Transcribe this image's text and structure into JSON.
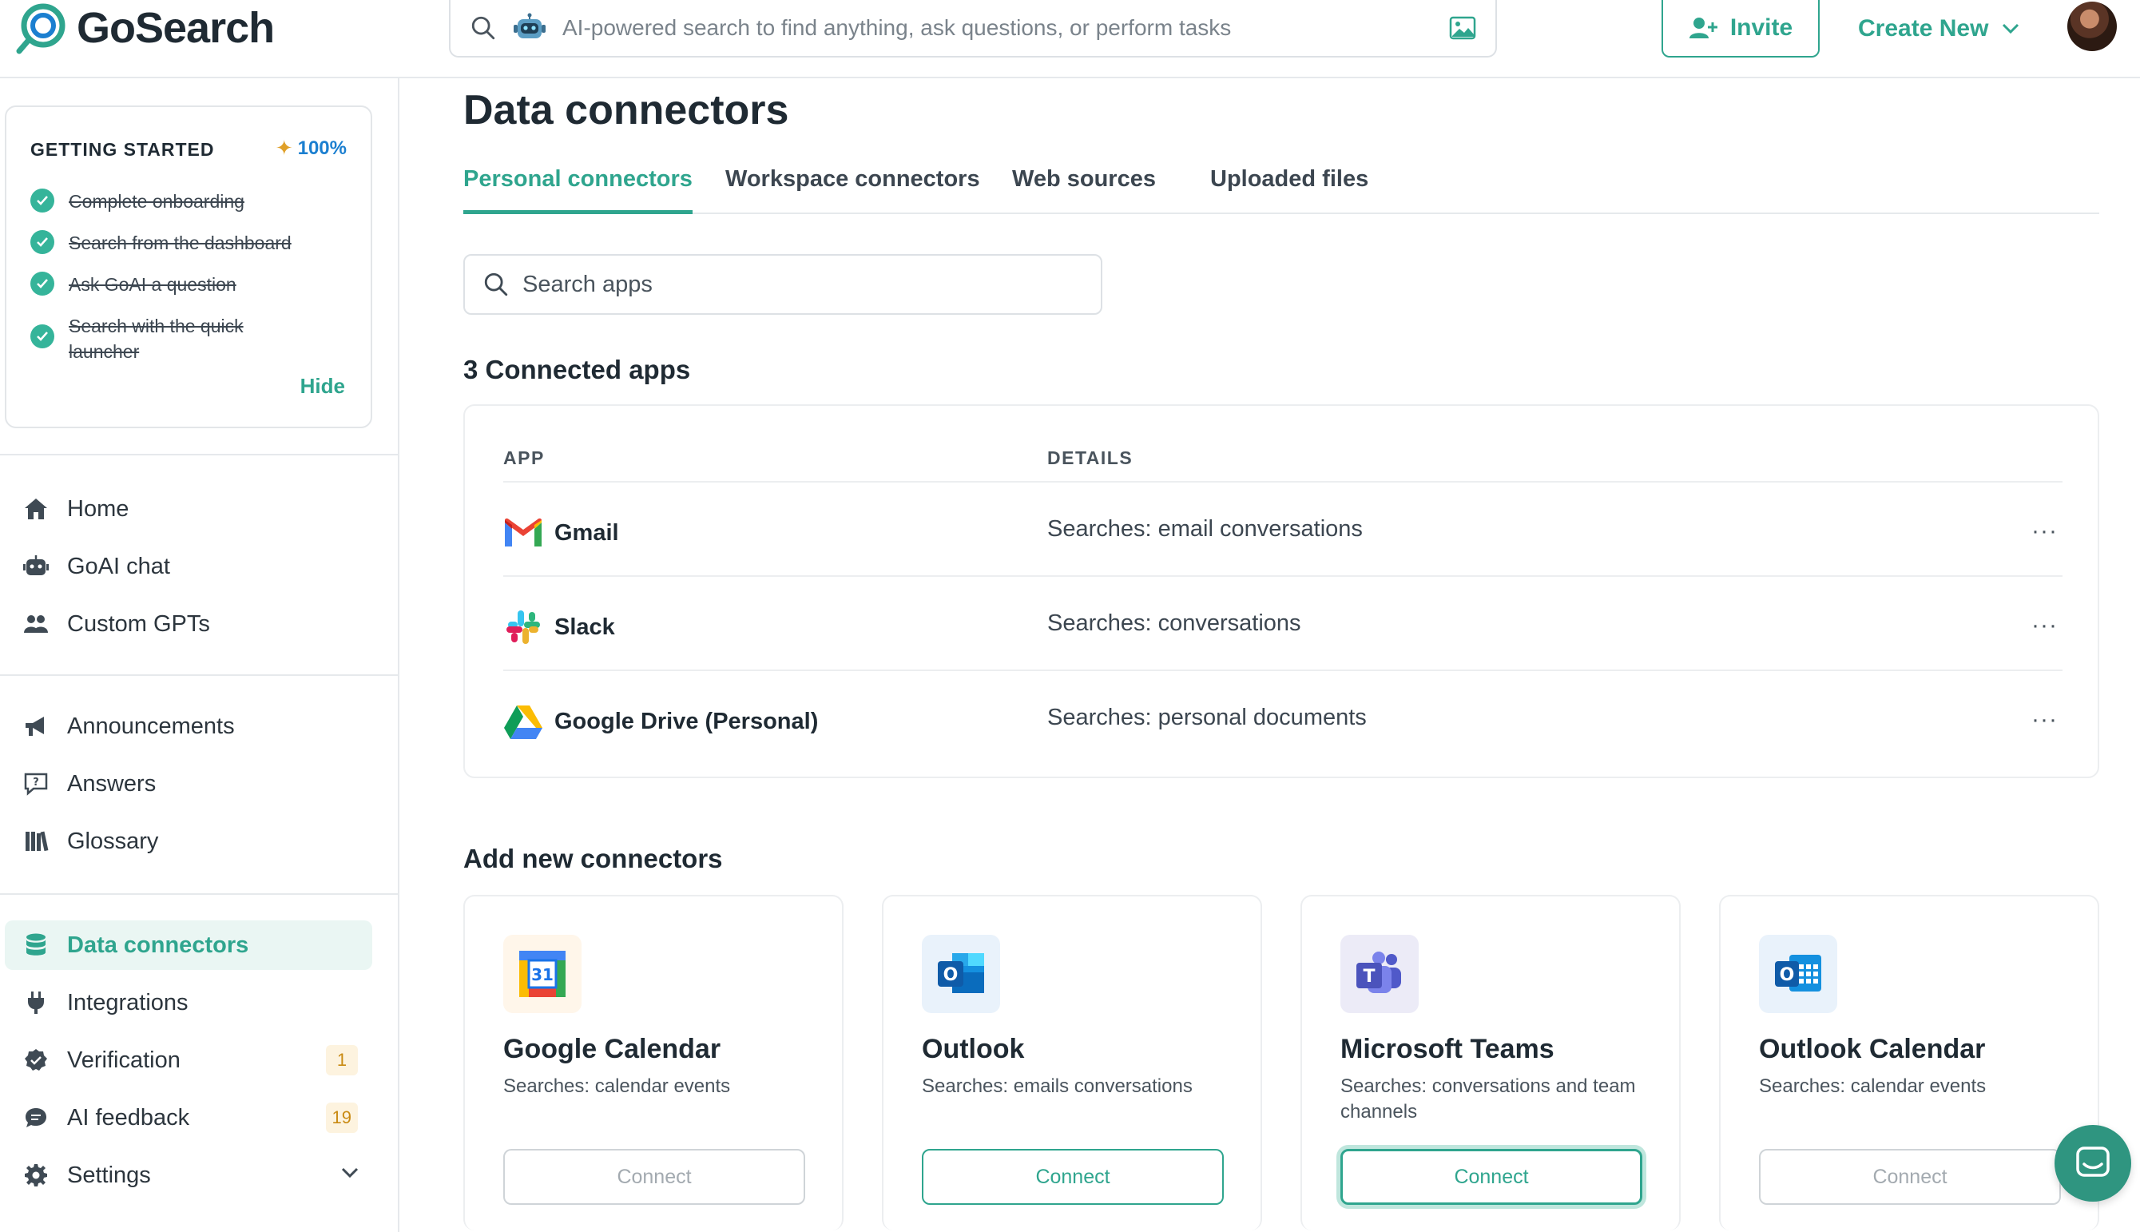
{
  "brand": {
    "name": "GoSearch"
  },
  "topbar": {
    "search_placeholder": "AI-powered search to find anything, ask questions, or perform tasks",
    "invite_label": "Invite",
    "create_new_label": "Create New"
  },
  "getting_started": {
    "title": "GETTING STARTED",
    "percent": "100%",
    "items": [
      "Complete onboarding",
      "Search from the dashboard",
      "Ask GoAI a question",
      "Search with the quick launcher"
    ],
    "hide_label": "Hide"
  },
  "sidebar": {
    "group1": [
      {
        "label": "Home",
        "icon": "home-icon"
      },
      {
        "label": "GoAI chat",
        "icon": "robot-icon"
      },
      {
        "label": "Custom GPTs",
        "icon": "gpts-icon"
      }
    ],
    "group2": [
      {
        "label": "Announcements",
        "icon": "megaphone-icon"
      },
      {
        "label": "Answers",
        "icon": "answers-icon"
      },
      {
        "label": "Glossary",
        "icon": "glossary-icon"
      }
    ],
    "group3": [
      {
        "label": "Data connectors",
        "icon": "database-icon",
        "active": true
      },
      {
        "label": "Integrations",
        "icon": "plug-icon"
      },
      {
        "label": "Verification",
        "icon": "verified-icon",
        "badge": "1"
      },
      {
        "label": "AI feedback",
        "icon": "feedback-icon",
        "badge": "19"
      },
      {
        "label": "Settings",
        "icon": "gear-icon"
      }
    ]
  },
  "main": {
    "title": "Data connectors",
    "tabs": [
      "Personal connectors",
      "Workspace connectors",
      "Web sources",
      "Uploaded files"
    ],
    "active_tab": 0,
    "app_search_placeholder": "Search apps",
    "connected_heading": "3 Connected apps",
    "table": {
      "headers": [
        "APP",
        "DETAILS"
      ],
      "rows": [
        {
          "app": "Gmail",
          "details": "Searches: email conversations",
          "icon": "gmail-icon"
        },
        {
          "app": "Slack",
          "details": "Searches: conversations",
          "icon": "slack-icon"
        },
        {
          "app": "Google Drive (Personal)",
          "details": "Searches: personal documents",
          "icon": "google-drive-icon"
        }
      ],
      "more_label": "···"
    },
    "add_heading": "Add new connectors",
    "connectors": [
      {
        "name": "Google Calendar",
        "desc": "Searches: calendar events",
        "button": "Connect",
        "icon": "google-calendar-icon",
        "icon_text": "31"
      },
      {
        "name": "Outlook",
        "desc": "Searches: emails conversations",
        "button": "Connect",
        "icon": "outlook-icon",
        "icon_text": "O"
      },
      {
        "name": "Microsoft Teams",
        "desc": "Searches: conversations and team channels",
        "button": "Connect",
        "icon": "microsoft-teams-icon",
        "icon_text": "T"
      },
      {
        "name": "Outlook Calendar",
        "desc": "Searches: calendar events",
        "button": "Connect",
        "icon": "outlook-calendar-icon",
        "icon_text": "O"
      }
    ]
  },
  "colors": {
    "accent": "#2fa58e",
    "active_bg": "#eaf6f3",
    "badge_bg": "#fdf3df",
    "badge_text": "#c98a12",
    "link_blue": "#1b7fd0"
  }
}
